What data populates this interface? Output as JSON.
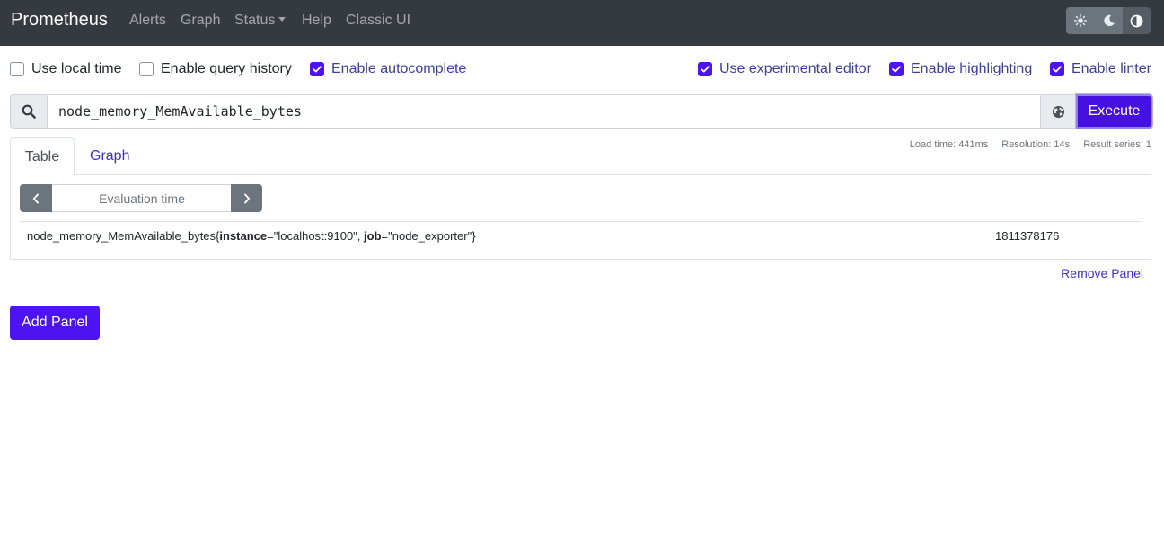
{
  "navbar": {
    "brand": "Prometheus",
    "links": {
      "alerts": "Alerts",
      "graph": "Graph",
      "status": "Status",
      "help": "Help",
      "classic": "Classic UI"
    },
    "theme_buttons": [
      "sun-icon",
      "moon-icon",
      "contrast-icon"
    ],
    "active_theme_button": "contrast-icon"
  },
  "options": {
    "local_time": {
      "label": "Use local time",
      "checked": false
    },
    "query_history": {
      "label": "Enable query history",
      "checked": false
    },
    "autocomplete": {
      "label": "Enable autocomplete",
      "checked": true
    },
    "experimental_editor": {
      "label": "Use experimental editor",
      "checked": true
    },
    "highlighting": {
      "label": "Enable highlighting",
      "checked": true
    },
    "linter": {
      "label": "Enable linter",
      "checked": true
    }
  },
  "query": {
    "expression": "node_memory_MemAvailable_bytes",
    "execute_label": "Execute"
  },
  "stats": {
    "load_time": "Load time: 441ms",
    "resolution": "Resolution: 14s",
    "result_series": "Result series: 1"
  },
  "tabs": {
    "table": "Table",
    "graph": "Graph",
    "active": "Table"
  },
  "table_view": {
    "eval_time_placeholder": "Evaluation time",
    "series": [
      {
        "metric": "node_memory_MemAvailable_bytes",
        "open_brace": "{",
        "label1_key": "instance",
        "label1_value": "=\"localhost:9100\", ",
        "label2_key": "job",
        "label2_value": "=\"node_exporter\"",
        "close_brace": "}",
        "value": "1811378176"
      }
    ]
  },
  "panel_actions": {
    "remove": "Remove Panel",
    "add": "Add Panel"
  },
  "colors": {
    "navbar_bg": "#343a40",
    "primary": "#4d13f1",
    "link": "#3b2fd6"
  }
}
